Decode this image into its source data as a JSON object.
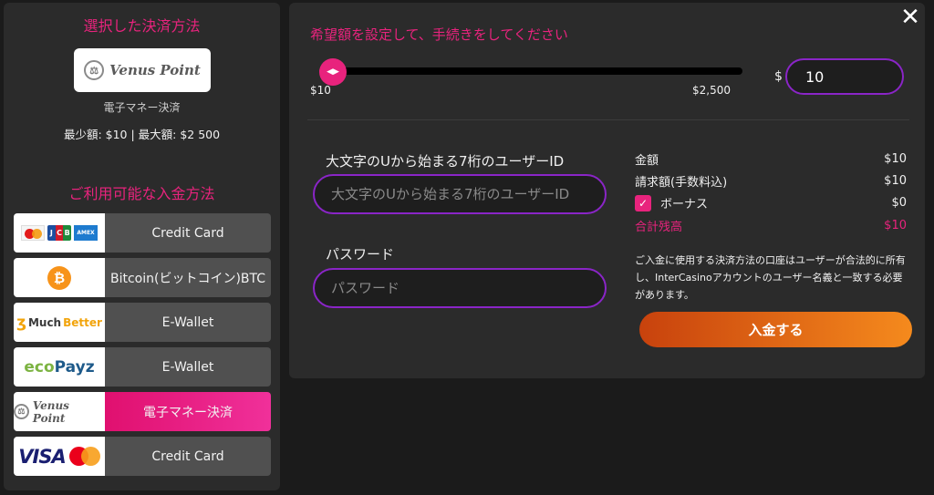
{
  "left": {
    "selected_heading": "選択した決済方法",
    "selected_method_logo": "Venus Point",
    "selected_method_sub": "電子マネー決済",
    "limits": "最少額: $10 | 最大額: $2 500",
    "available_heading": "ご利用可能な入金方法",
    "methods": [
      {
        "logo": "credit-card-brands",
        "label": "Credit Card"
      },
      {
        "logo": "bitcoin",
        "label": "Bitcoin(ビットコイン)BTC"
      },
      {
        "logo": "MuchBetter",
        "label": "E-Wallet"
      },
      {
        "logo": "ecoPayz",
        "label": "E-Wallet"
      },
      {
        "logo": "Venus Point",
        "label": "電子マネー決済",
        "active": true
      },
      {
        "logo": "visa-mastercard",
        "label": "Credit Card"
      }
    ],
    "logo_text": {
      "jcb": [
        "J",
        "C",
        "B"
      ],
      "amex": "AMEX",
      "btc": "₿",
      "much": "Much",
      "better": "Better",
      "eco": "eco",
      "payz": "Payz",
      "visa": "VISA"
    }
  },
  "main": {
    "title": "希望額を設定して、手続きをしてください",
    "slider": {
      "min_label": "$10",
      "max_label": "$2,500",
      "min": 10,
      "max": 2500,
      "value": 10,
      "thumb_glyph": "◀▶"
    },
    "currency_symbol": "$",
    "amount_value": "10",
    "user_id_label": "大文字のUから始まる7桁のユーザーID",
    "user_id_placeholder": "大文字のUから始まる7桁のユーザーID",
    "password_label": "パスワード",
    "password_placeholder": "パスワード",
    "summary": {
      "amount_label": "金額",
      "amount_value": "$10",
      "billed_label": "請求額(手数料込)",
      "billed_value": "$10",
      "bonus_label": "ボーナス",
      "bonus_value": "$0",
      "total_label": "合計残高",
      "total_value": "$10"
    },
    "note": "ご入金に使用する決済方法の口座はユーザーが合法的に所有し、InterCasinoアカウントのユーザー名義と一致する必要があります。",
    "deposit_button": "入金する",
    "close_glyph": "✕"
  },
  "colors": {
    "accent": "#e8237d",
    "input_border": "#8a25c7",
    "button_start": "#c8420d",
    "button_end": "#f58a1d"
  }
}
